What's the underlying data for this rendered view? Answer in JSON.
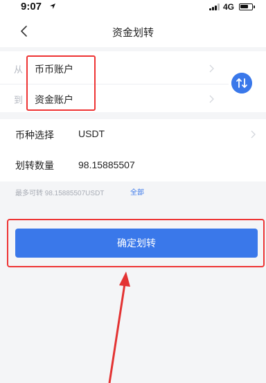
{
  "status_bar": {
    "time": "9:07",
    "network": "4G"
  },
  "nav": {
    "title": "资金划转"
  },
  "transfer": {
    "from_label": "从",
    "from_account": "币币账户",
    "to_label": "到",
    "to_account": "资金账户"
  },
  "form": {
    "coin_label": "币种选择",
    "coin_value": "USDT",
    "amount_label": "划转数量",
    "amount_value": "98.15885507"
  },
  "max_transfer": {
    "text": "最多可转 98.15885507USDT",
    "all_label": "全部"
  },
  "confirm_label": "确定划转",
  "colors": {
    "accent": "#3a78ea",
    "annotation": "#e33333"
  },
  "icons": [
    "location-arrow-icon",
    "signal-icon",
    "battery-icon",
    "back-chevron-icon",
    "chevron-right-icon",
    "swap-icon"
  ]
}
